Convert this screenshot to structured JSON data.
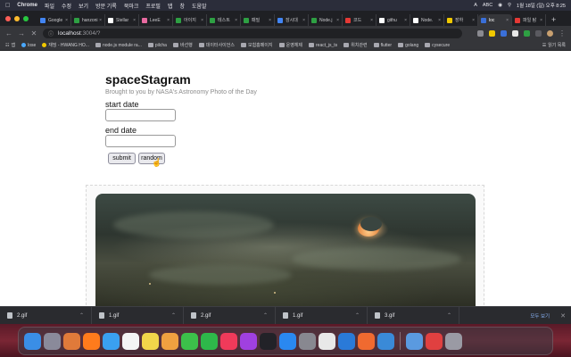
{
  "menubar": {
    "app": "Chrome",
    "items": [
      "파일",
      "수정",
      "보기",
      "방문 기록",
      "북마크",
      "프로필",
      "탭",
      "창",
      "도움말"
    ],
    "status": [
      "A",
      "ABC",
      "1월 18일 (일) 오후 8:25"
    ]
  },
  "tabs": [
    {
      "label": "Google",
      "color": "#4285f4"
    },
    {
      "label": "hanzoni",
      "color": "#2ea043"
    },
    {
      "label": "Stellar",
      "color": "#ffffff"
    },
    {
      "label": "LeeE",
      "color": "#e86aa0"
    },
    {
      "label": "아이지",
      "color": "#2ea043"
    },
    {
      "label": "테스트",
      "color": "#2ea043"
    },
    {
      "label": "패밀",
      "color": "#2ea043"
    },
    {
      "label": "잠시대",
      "color": "#4285f4"
    },
    {
      "label": "Node.j",
      "color": "#2ea043"
    },
    {
      "label": "코드",
      "color": "#e53935"
    },
    {
      "label": "githu",
      "color": "#ffffff"
    },
    {
      "label": "Node.",
      "color": "#ffffff"
    },
    {
      "label": "장하",
      "color": "#f0c800"
    },
    {
      "label": "loc",
      "color": "#3a6fd8",
      "active": true
    },
    {
      "label": "파일 탐",
      "color": "#e53935"
    }
  ],
  "toolbar": {
    "url_host": "localhost",
    "url_port": ":3004/?"
  },
  "bookmarks": {
    "items": [
      {
        "label": "앱",
        "kind": "grid"
      },
      {
        "label": "lose",
        "kind": "dot",
        "color": "#4aa8ff"
      },
      {
        "label": "재밍 - HWANG HO...",
        "kind": "dot",
        "color": "#f0c800"
      },
      {
        "label": "node.js module ra...",
        "kind": "folder"
      },
      {
        "label": "pilcha",
        "kind": "folder"
      },
      {
        "label": "바선행",
        "kind": "folder"
      },
      {
        "label": "데이터사이언스",
        "kind": "folder"
      },
      {
        "label": "모험홈페이지",
        "kind": "folder"
      },
      {
        "label": "운영체제",
        "kind": "folder"
      },
      {
        "label": "react_js_ts",
        "kind": "folder"
      },
      {
        "label": "위치관련",
        "kind": "folder"
      },
      {
        "label": "flutter",
        "kind": "folder"
      },
      {
        "label": "golang",
        "kind": "folder"
      },
      {
        "label": "cysecure",
        "kind": "folder"
      }
    ],
    "reading_list": "읽기 목록"
  },
  "page": {
    "title": "spaceStagram",
    "subtitle": "Brought to you by NASA's Astronomy Photo of the Day",
    "start_label": "start date",
    "end_label": "end date",
    "submit_label": "submit",
    "random_label": "random"
  },
  "downloads": {
    "items": [
      "2.gif",
      "1.gif",
      "2.gif",
      "1.gif",
      "3.gif"
    ],
    "show_all": "모두 보기"
  },
  "dock": {
    "icons": [
      {
        "name": "finder",
        "color": "#3a8ee6"
      },
      {
        "name": "launchpad",
        "color": "#8a8a9a"
      },
      {
        "name": "launchpad-grid",
        "color": "#e07a3a"
      },
      {
        "name": "firefox",
        "color": "#ff7b1c"
      },
      {
        "name": "mail",
        "color": "#3aa0f0"
      },
      {
        "name": "calendar",
        "color": "#f4f4f4"
      },
      {
        "name": "notes",
        "color": "#f2d54a"
      },
      {
        "name": "photos",
        "color": "#f0a040"
      },
      {
        "name": "messages",
        "color": "#3cc04a"
      },
      {
        "name": "facetime",
        "color": "#2eb84a"
      },
      {
        "name": "music",
        "color": "#f03a5a"
      },
      {
        "name": "podcasts",
        "color": "#a040e0"
      },
      {
        "name": "apple-tv",
        "color": "#222228"
      },
      {
        "name": "app-store",
        "color": "#2a88f0"
      },
      {
        "name": "system-preferences",
        "color": "#888890"
      },
      {
        "name": "chrome",
        "color": "#e8e8e8"
      },
      {
        "name": "vscode",
        "color": "#2a7ad8"
      },
      {
        "name": "postman",
        "color": "#f06a30"
      },
      {
        "name": "quicktime",
        "color": "#3a8ad8"
      },
      {
        "name": "preview",
        "color": "#5a9ae0"
      },
      {
        "name": "screenshot",
        "color": "#e04040"
      },
      {
        "name": "trash",
        "color": "#9a9aa4"
      }
    ]
  }
}
